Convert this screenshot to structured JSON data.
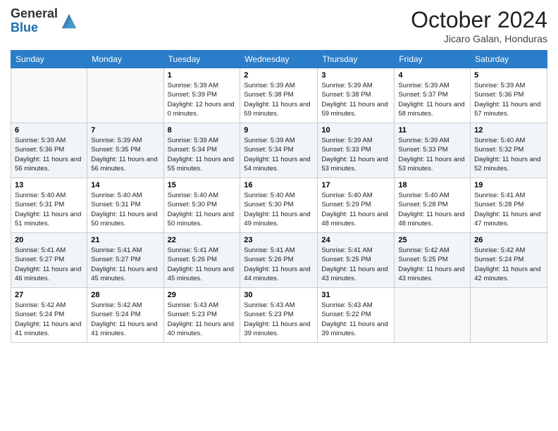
{
  "header": {
    "logo_line1": "General",
    "logo_line2": "Blue",
    "month": "October 2024",
    "location": "Jicaro Galan, Honduras"
  },
  "weekdays": [
    "Sunday",
    "Monday",
    "Tuesday",
    "Wednesday",
    "Thursday",
    "Friday",
    "Saturday"
  ],
  "weeks": [
    [
      {
        "day": "",
        "sunrise": "",
        "sunset": "",
        "daylight": ""
      },
      {
        "day": "",
        "sunrise": "",
        "sunset": "",
        "daylight": ""
      },
      {
        "day": "1",
        "sunrise": "Sunrise: 5:39 AM",
        "sunset": "Sunset: 5:39 PM",
        "daylight": "Daylight: 12 hours and 0 minutes."
      },
      {
        "day": "2",
        "sunrise": "Sunrise: 5:39 AM",
        "sunset": "Sunset: 5:38 PM",
        "daylight": "Daylight: 11 hours and 59 minutes."
      },
      {
        "day": "3",
        "sunrise": "Sunrise: 5:39 AM",
        "sunset": "Sunset: 5:38 PM",
        "daylight": "Daylight: 11 hours and 59 minutes."
      },
      {
        "day": "4",
        "sunrise": "Sunrise: 5:39 AM",
        "sunset": "Sunset: 5:37 PM",
        "daylight": "Daylight: 11 hours and 58 minutes."
      },
      {
        "day": "5",
        "sunrise": "Sunrise: 5:39 AM",
        "sunset": "Sunset: 5:36 PM",
        "daylight": "Daylight: 11 hours and 57 minutes."
      }
    ],
    [
      {
        "day": "6",
        "sunrise": "Sunrise: 5:39 AM",
        "sunset": "Sunset: 5:36 PM",
        "daylight": "Daylight: 11 hours and 56 minutes."
      },
      {
        "day": "7",
        "sunrise": "Sunrise: 5:39 AM",
        "sunset": "Sunset: 5:35 PM",
        "daylight": "Daylight: 11 hours and 56 minutes."
      },
      {
        "day": "8",
        "sunrise": "Sunrise: 5:39 AM",
        "sunset": "Sunset: 5:34 PM",
        "daylight": "Daylight: 11 hours and 55 minutes."
      },
      {
        "day": "9",
        "sunrise": "Sunrise: 5:39 AM",
        "sunset": "Sunset: 5:34 PM",
        "daylight": "Daylight: 11 hours and 54 minutes."
      },
      {
        "day": "10",
        "sunrise": "Sunrise: 5:39 AM",
        "sunset": "Sunset: 5:33 PM",
        "daylight": "Daylight: 11 hours and 53 minutes."
      },
      {
        "day": "11",
        "sunrise": "Sunrise: 5:39 AM",
        "sunset": "Sunset: 5:33 PM",
        "daylight": "Daylight: 11 hours and 53 minutes."
      },
      {
        "day": "12",
        "sunrise": "Sunrise: 5:40 AM",
        "sunset": "Sunset: 5:32 PM",
        "daylight": "Daylight: 11 hours and 52 minutes."
      }
    ],
    [
      {
        "day": "13",
        "sunrise": "Sunrise: 5:40 AM",
        "sunset": "Sunset: 5:31 PM",
        "daylight": "Daylight: 11 hours and 51 minutes."
      },
      {
        "day": "14",
        "sunrise": "Sunrise: 5:40 AM",
        "sunset": "Sunset: 5:31 PM",
        "daylight": "Daylight: 11 hours and 50 minutes."
      },
      {
        "day": "15",
        "sunrise": "Sunrise: 5:40 AM",
        "sunset": "Sunset: 5:30 PM",
        "daylight": "Daylight: 11 hours and 50 minutes."
      },
      {
        "day": "16",
        "sunrise": "Sunrise: 5:40 AM",
        "sunset": "Sunset: 5:30 PM",
        "daylight": "Daylight: 11 hours and 49 minutes."
      },
      {
        "day": "17",
        "sunrise": "Sunrise: 5:40 AM",
        "sunset": "Sunset: 5:29 PM",
        "daylight": "Daylight: 11 hours and 48 minutes."
      },
      {
        "day": "18",
        "sunrise": "Sunrise: 5:40 AM",
        "sunset": "Sunset: 5:28 PM",
        "daylight": "Daylight: 11 hours and 48 minutes."
      },
      {
        "day": "19",
        "sunrise": "Sunrise: 5:41 AM",
        "sunset": "Sunset: 5:28 PM",
        "daylight": "Daylight: 11 hours and 47 minutes."
      }
    ],
    [
      {
        "day": "20",
        "sunrise": "Sunrise: 5:41 AM",
        "sunset": "Sunset: 5:27 PM",
        "daylight": "Daylight: 11 hours and 46 minutes."
      },
      {
        "day": "21",
        "sunrise": "Sunrise: 5:41 AM",
        "sunset": "Sunset: 5:27 PM",
        "daylight": "Daylight: 11 hours and 45 minutes."
      },
      {
        "day": "22",
        "sunrise": "Sunrise: 5:41 AM",
        "sunset": "Sunset: 5:26 PM",
        "daylight": "Daylight: 11 hours and 45 minutes."
      },
      {
        "day": "23",
        "sunrise": "Sunrise: 5:41 AM",
        "sunset": "Sunset: 5:26 PM",
        "daylight": "Daylight: 11 hours and 44 minutes."
      },
      {
        "day": "24",
        "sunrise": "Sunrise: 5:41 AM",
        "sunset": "Sunset: 5:25 PM",
        "daylight": "Daylight: 11 hours and 43 minutes."
      },
      {
        "day": "25",
        "sunrise": "Sunrise: 5:42 AM",
        "sunset": "Sunset: 5:25 PM",
        "daylight": "Daylight: 11 hours and 43 minutes."
      },
      {
        "day": "26",
        "sunrise": "Sunrise: 5:42 AM",
        "sunset": "Sunset: 5:24 PM",
        "daylight": "Daylight: 11 hours and 42 minutes."
      }
    ],
    [
      {
        "day": "27",
        "sunrise": "Sunrise: 5:42 AM",
        "sunset": "Sunset: 5:24 PM",
        "daylight": "Daylight: 11 hours and 41 minutes."
      },
      {
        "day": "28",
        "sunrise": "Sunrise: 5:42 AM",
        "sunset": "Sunset: 5:24 PM",
        "daylight": "Daylight: 11 hours and 41 minutes."
      },
      {
        "day": "29",
        "sunrise": "Sunrise: 5:43 AM",
        "sunset": "Sunset: 5:23 PM",
        "daylight": "Daylight: 11 hours and 40 minutes."
      },
      {
        "day": "30",
        "sunrise": "Sunrise: 5:43 AM",
        "sunset": "Sunset: 5:23 PM",
        "daylight": "Daylight: 11 hours and 39 minutes."
      },
      {
        "day": "31",
        "sunrise": "Sunrise: 5:43 AM",
        "sunset": "Sunset: 5:22 PM",
        "daylight": "Daylight: 11 hours and 39 minutes."
      },
      {
        "day": "",
        "sunrise": "",
        "sunset": "",
        "daylight": ""
      },
      {
        "day": "",
        "sunrise": "",
        "sunset": "",
        "daylight": ""
      }
    ]
  ]
}
